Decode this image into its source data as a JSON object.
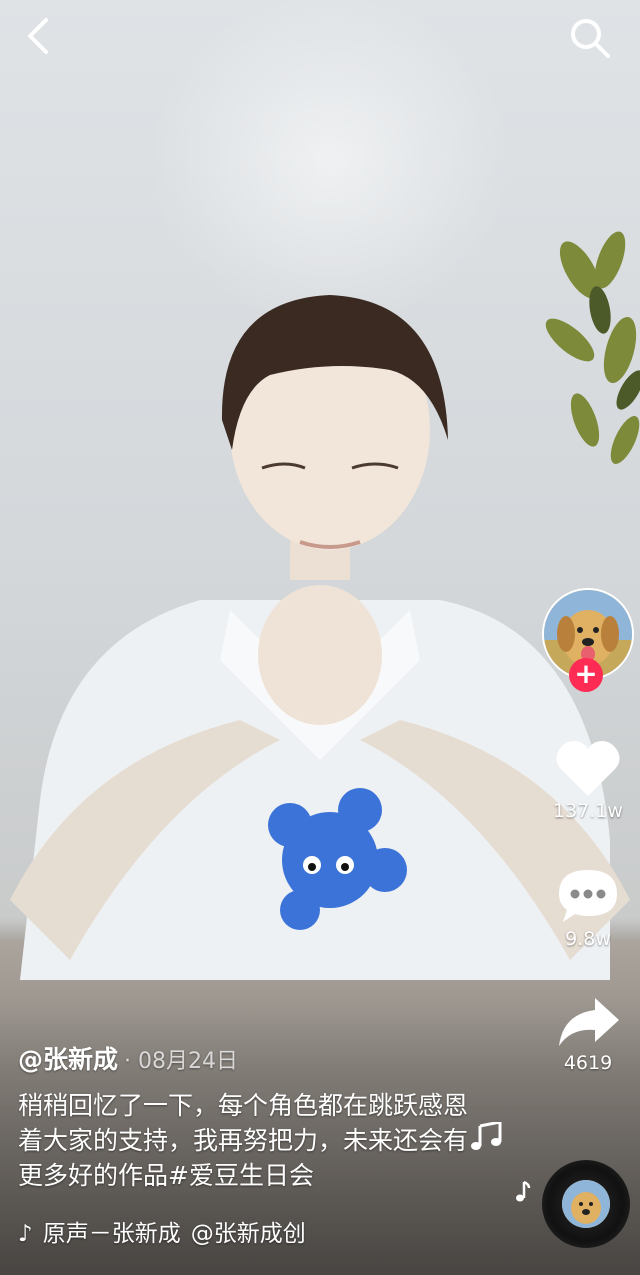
{
  "author": {
    "handle": "@张新成",
    "date": "· 08月24日"
  },
  "description": "稍稍回忆了一下，每个角色都在跳跃感恩着大家的支持，我再努把力，未来还会有更多好的作品#爱豆生日会",
  "music": {
    "sound": "原声－张新成",
    "creator": "@张新成创"
  },
  "stats": {
    "likes": "137.1w",
    "comments": "9.8w",
    "shares": "4619"
  },
  "icons": {
    "back": "back-arrow-icon",
    "search": "search-icon",
    "like": "heart-icon",
    "comment": "comment-icon",
    "share": "share-arrow-icon",
    "music": "music-note-icon",
    "tiktok": "douyin-logo-icon",
    "follow": "plus-icon"
  },
  "colors": {
    "accent": "#fe2c55",
    "text": "#ffffff"
  }
}
